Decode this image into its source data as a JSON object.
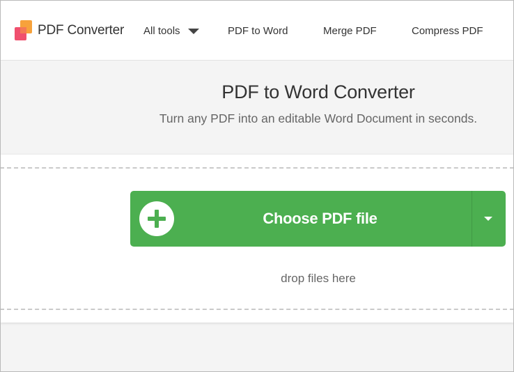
{
  "header": {
    "brand": "PDF Converter",
    "nav": {
      "all_tools": "All tools",
      "pdf_to_word": "PDF to Word",
      "merge_pdf": "Merge PDF",
      "compress_pdf": "Compress PDF"
    },
    "logo_icon": "pdf-converter-logo-icon",
    "caret_icon": "chevron-down-icon"
  },
  "hero": {
    "title": "PDF to Word Converter",
    "subtitle": "Turn any PDF into an editable Word Document in seconds."
  },
  "upload": {
    "choose_label": "Choose PDF file",
    "drop_hint": "drop files here",
    "plus_icon": "plus-icon",
    "dropdown_icon": "chevron-down-icon"
  },
  "colors": {
    "accent_green": "#4caf50",
    "logo_pink": "#f0506e",
    "logo_orange": "#f7a23b",
    "background": "#f4f4f4"
  }
}
